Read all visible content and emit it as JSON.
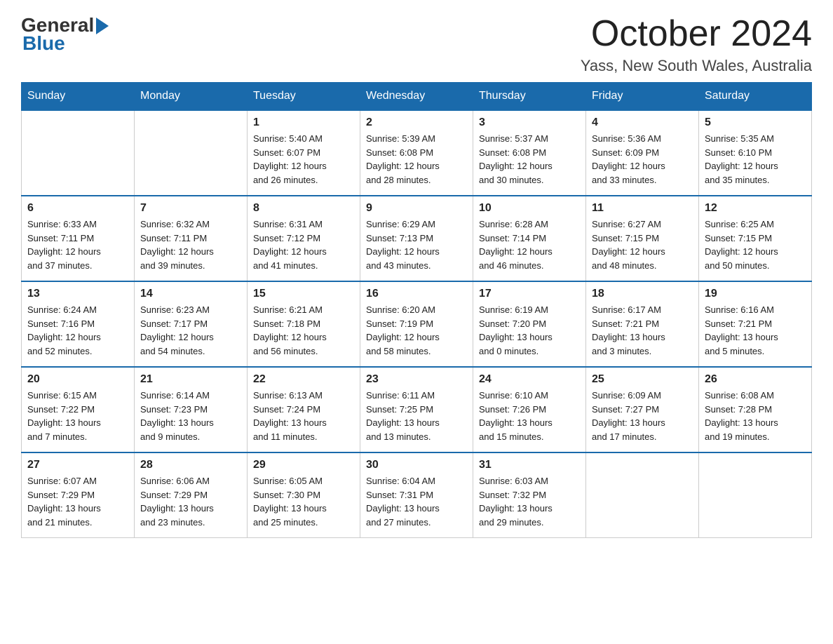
{
  "header": {
    "logo_general": "General",
    "logo_blue": "Blue",
    "month_title": "October 2024",
    "location": "Yass, New South Wales, Australia"
  },
  "days_of_week": [
    "Sunday",
    "Monday",
    "Tuesday",
    "Wednesday",
    "Thursday",
    "Friday",
    "Saturday"
  ],
  "weeks": [
    [
      {
        "day": "",
        "info": ""
      },
      {
        "day": "",
        "info": ""
      },
      {
        "day": "1",
        "info": "Sunrise: 5:40 AM\nSunset: 6:07 PM\nDaylight: 12 hours\nand 26 minutes."
      },
      {
        "day": "2",
        "info": "Sunrise: 5:39 AM\nSunset: 6:08 PM\nDaylight: 12 hours\nand 28 minutes."
      },
      {
        "day": "3",
        "info": "Sunrise: 5:37 AM\nSunset: 6:08 PM\nDaylight: 12 hours\nand 30 minutes."
      },
      {
        "day": "4",
        "info": "Sunrise: 5:36 AM\nSunset: 6:09 PM\nDaylight: 12 hours\nand 33 minutes."
      },
      {
        "day": "5",
        "info": "Sunrise: 5:35 AM\nSunset: 6:10 PM\nDaylight: 12 hours\nand 35 minutes."
      }
    ],
    [
      {
        "day": "6",
        "info": "Sunrise: 6:33 AM\nSunset: 7:11 PM\nDaylight: 12 hours\nand 37 minutes."
      },
      {
        "day": "7",
        "info": "Sunrise: 6:32 AM\nSunset: 7:11 PM\nDaylight: 12 hours\nand 39 minutes."
      },
      {
        "day": "8",
        "info": "Sunrise: 6:31 AM\nSunset: 7:12 PM\nDaylight: 12 hours\nand 41 minutes."
      },
      {
        "day": "9",
        "info": "Sunrise: 6:29 AM\nSunset: 7:13 PM\nDaylight: 12 hours\nand 43 minutes."
      },
      {
        "day": "10",
        "info": "Sunrise: 6:28 AM\nSunset: 7:14 PM\nDaylight: 12 hours\nand 46 minutes."
      },
      {
        "day": "11",
        "info": "Sunrise: 6:27 AM\nSunset: 7:15 PM\nDaylight: 12 hours\nand 48 minutes."
      },
      {
        "day": "12",
        "info": "Sunrise: 6:25 AM\nSunset: 7:15 PM\nDaylight: 12 hours\nand 50 minutes."
      }
    ],
    [
      {
        "day": "13",
        "info": "Sunrise: 6:24 AM\nSunset: 7:16 PM\nDaylight: 12 hours\nand 52 minutes."
      },
      {
        "day": "14",
        "info": "Sunrise: 6:23 AM\nSunset: 7:17 PM\nDaylight: 12 hours\nand 54 minutes."
      },
      {
        "day": "15",
        "info": "Sunrise: 6:21 AM\nSunset: 7:18 PM\nDaylight: 12 hours\nand 56 minutes."
      },
      {
        "day": "16",
        "info": "Sunrise: 6:20 AM\nSunset: 7:19 PM\nDaylight: 12 hours\nand 58 minutes."
      },
      {
        "day": "17",
        "info": "Sunrise: 6:19 AM\nSunset: 7:20 PM\nDaylight: 13 hours\nand 0 minutes."
      },
      {
        "day": "18",
        "info": "Sunrise: 6:17 AM\nSunset: 7:21 PM\nDaylight: 13 hours\nand 3 minutes."
      },
      {
        "day": "19",
        "info": "Sunrise: 6:16 AM\nSunset: 7:21 PM\nDaylight: 13 hours\nand 5 minutes."
      }
    ],
    [
      {
        "day": "20",
        "info": "Sunrise: 6:15 AM\nSunset: 7:22 PM\nDaylight: 13 hours\nand 7 minutes."
      },
      {
        "day": "21",
        "info": "Sunrise: 6:14 AM\nSunset: 7:23 PM\nDaylight: 13 hours\nand 9 minutes."
      },
      {
        "day": "22",
        "info": "Sunrise: 6:13 AM\nSunset: 7:24 PM\nDaylight: 13 hours\nand 11 minutes."
      },
      {
        "day": "23",
        "info": "Sunrise: 6:11 AM\nSunset: 7:25 PM\nDaylight: 13 hours\nand 13 minutes."
      },
      {
        "day": "24",
        "info": "Sunrise: 6:10 AM\nSunset: 7:26 PM\nDaylight: 13 hours\nand 15 minutes."
      },
      {
        "day": "25",
        "info": "Sunrise: 6:09 AM\nSunset: 7:27 PM\nDaylight: 13 hours\nand 17 minutes."
      },
      {
        "day": "26",
        "info": "Sunrise: 6:08 AM\nSunset: 7:28 PM\nDaylight: 13 hours\nand 19 minutes."
      }
    ],
    [
      {
        "day": "27",
        "info": "Sunrise: 6:07 AM\nSunset: 7:29 PM\nDaylight: 13 hours\nand 21 minutes."
      },
      {
        "day": "28",
        "info": "Sunrise: 6:06 AM\nSunset: 7:29 PM\nDaylight: 13 hours\nand 23 minutes."
      },
      {
        "day": "29",
        "info": "Sunrise: 6:05 AM\nSunset: 7:30 PM\nDaylight: 13 hours\nand 25 minutes."
      },
      {
        "day": "30",
        "info": "Sunrise: 6:04 AM\nSunset: 7:31 PM\nDaylight: 13 hours\nand 27 minutes."
      },
      {
        "day": "31",
        "info": "Sunrise: 6:03 AM\nSunset: 7:32 PM\nDaylight: 13 hours\nand 29 minutes."
      },
      {
        "day": "",
        "info": ""
      },
      {
        "day": "",
        "info": ""
      }
    ]
  ]
}
